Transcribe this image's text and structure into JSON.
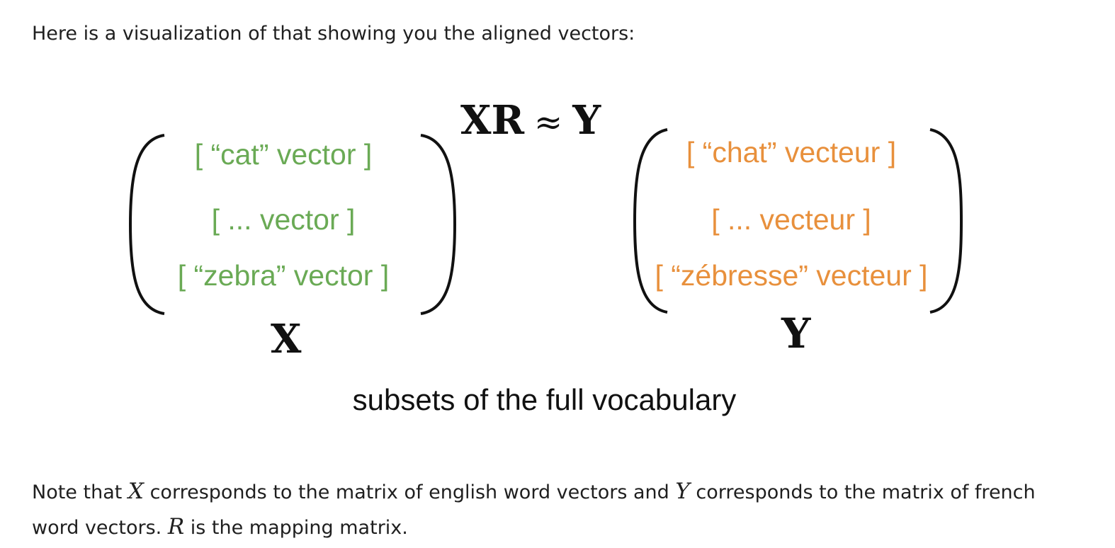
{
  "intro_text": "Here is a visualization of that showing you the aligned vectors:",
  "figure": {
    "equation": {
      "lhs": "XR",
      "symbol": "≈",
      "rhs": "Y"
    },
    "left_matrix": {
      "rows": [
        "[ “cat” vector ]",
        "[ ... vector ]",
        "[ “zebra” vector ]"
      ],
      "label": "X",
      "color": "#6aaa55"
    },
    "right_matrix": {
      "rows": [
        "[ “chat” vecteur ]",
        "[ ... vecteur ]",
        "[ “zébresse” vecteur ]"
      ],
      "label": "Y",
      "color": "#e8903c"
    },
    "caption": "subsets of the full vocabulary"
  },
  "note": {
    "part1": "Note that ",
    "var_x": "X",
    "part2": " corresponds to the matrix of english word vectors and ",
    "var_y": "Y",
    "part3": " corresponds to the matrix of french word vectors. ",
    "var_r": "R",
    "part4": " is the mapping matrix."
  }
}
